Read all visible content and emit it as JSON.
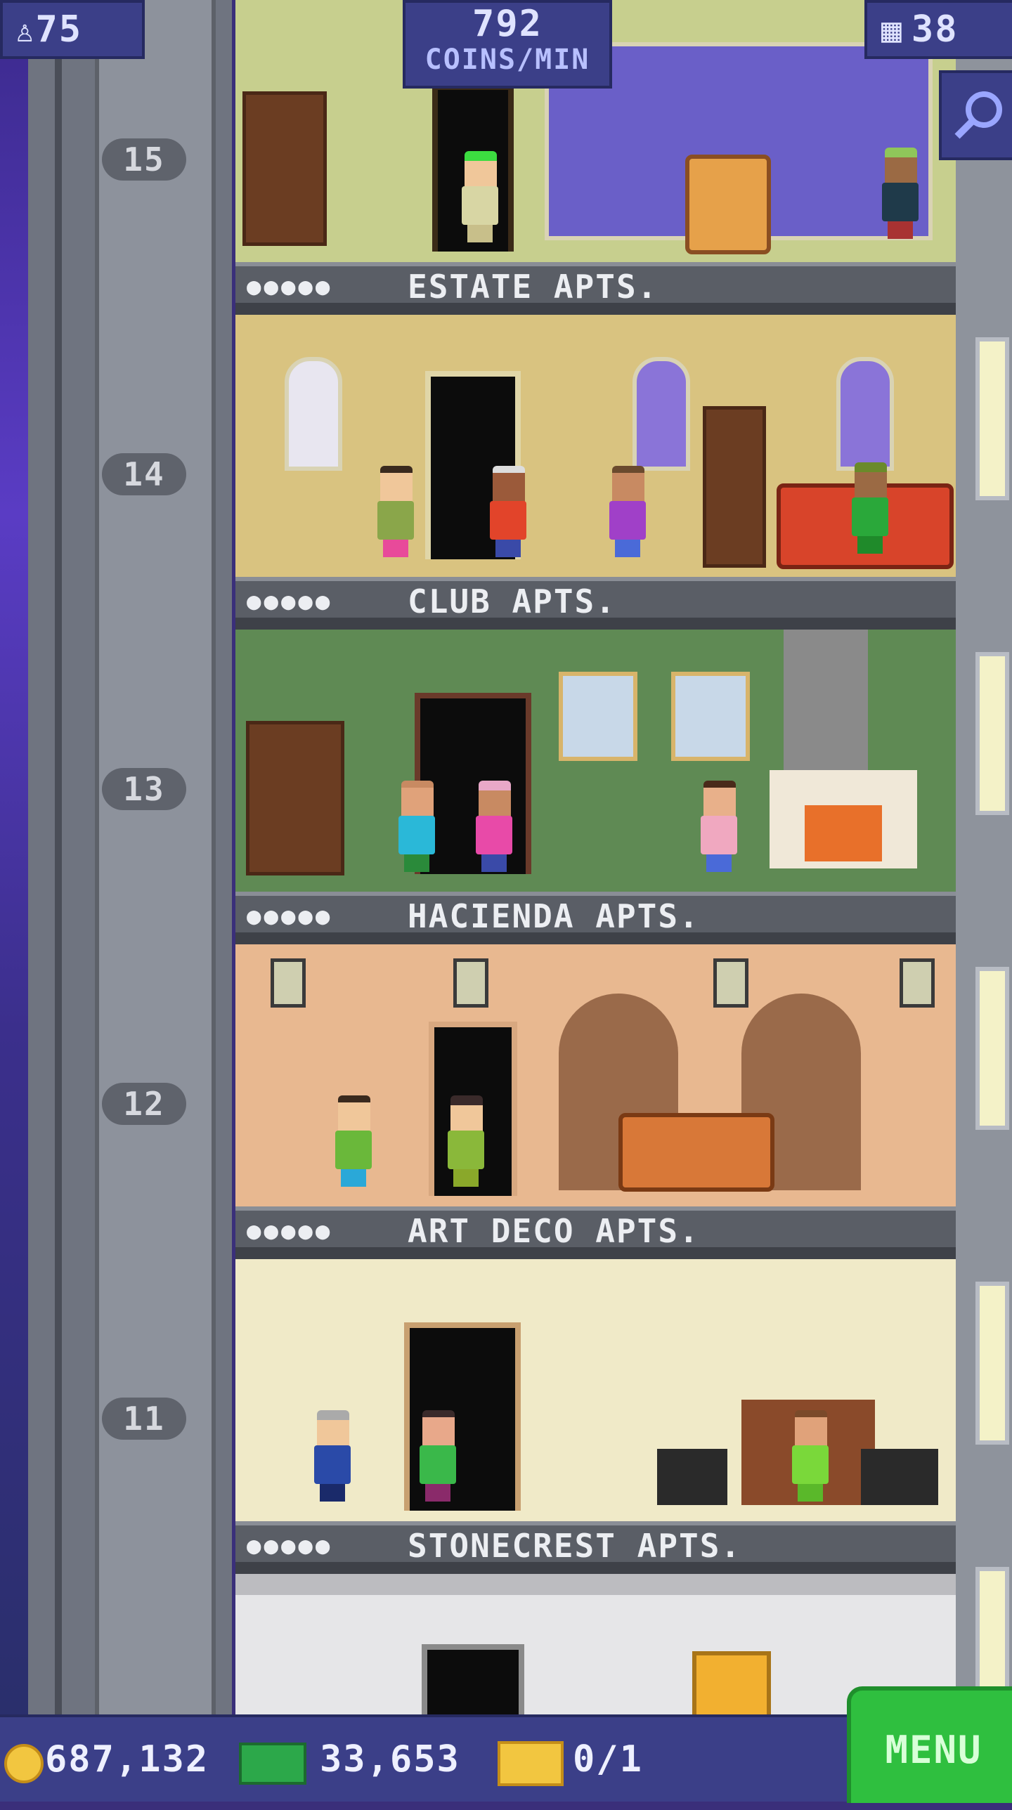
{
  "hud": {
    "population": "75",
    "coins_per_min_value": "792",
    "coins_per_min_unit": "COINS/MIN",
    "floors": "38"
  },
  "floors": [
    {
      "number": "15",
      "stars": "●●●●●",
      "name": "ESTATE APTS."
    },
    {
      "number": "14",
      "stars": "●●●●●",
      "name": "CLUB APTS."
    },
    {
      "number": "13",
      "stars": "●●●●●",
      "name": "HACIENDA APTS."
    },
    {
      "number": "12",
      "stars": "●●●●●",
      "name": "ART DECO APTS."
    },
    {
      "number": "11",
      "stars": "●●●●●",
      "name": "STONECREST APTS."
    }
  ],
  "bottom_bar": {
    "coins": "687,132",
    "bux": "33,653",
    "tickets": "0/1",
    "menu_label": "MENU"
  },
  "icons": {
    "population": "person-icon",
    "floors": "building-icon",
    "zoom": "magnifier-icon",
    "coins": "coin-icon",
    "bux": "tower-bux-icon",
    "tickets": "golden-ticket-icon"
  }
}
